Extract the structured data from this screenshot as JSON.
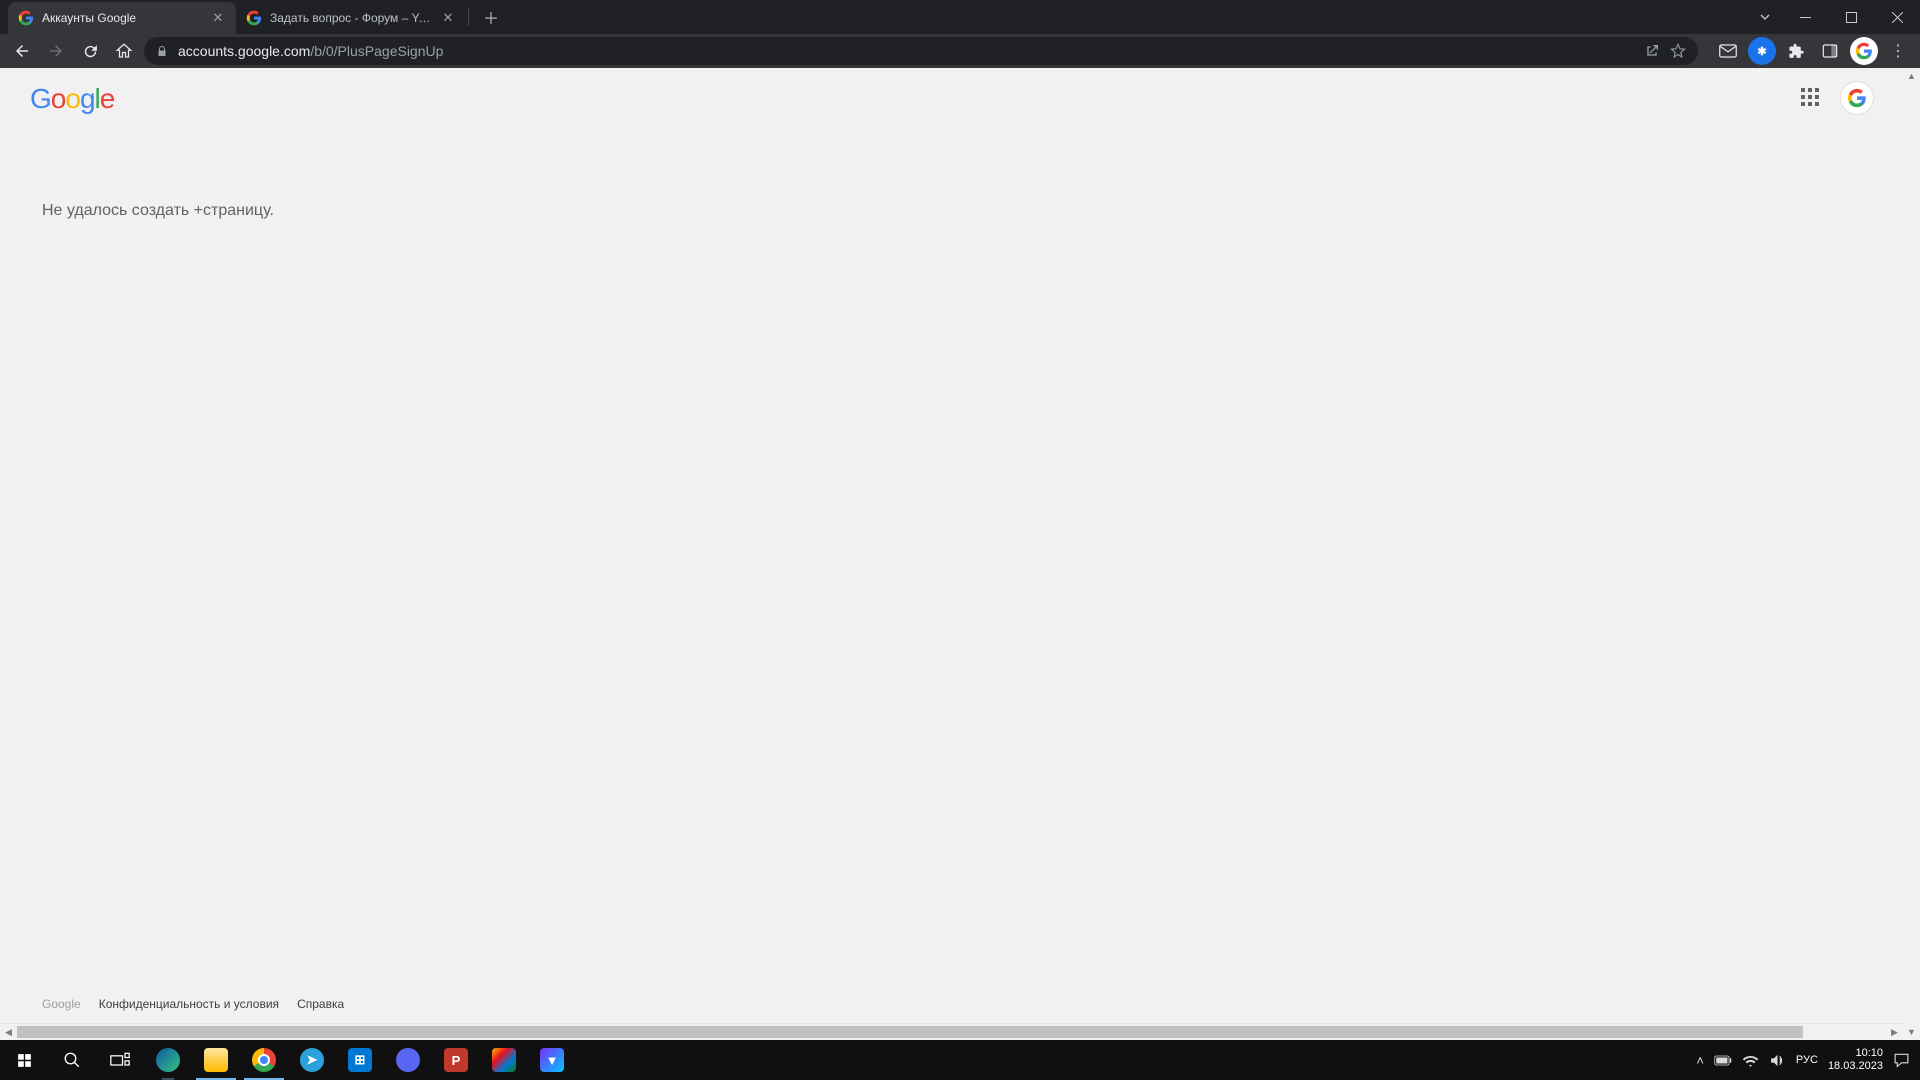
{
  "browser": {
    "tabs": [
      {
        "title": "Аккаунты Google",
        "active": true
      },
      {
        "title": "Задать вопрос - Форум – YouTu",
        "active": false
      }
    ],
    "url_host": "accounts.google.com",
    "url_path": "/b/0/PlusPageSignUp"
  },
  "page": {
    "logo_text": "Google",
    "message": "Не удалось создать +страницу.",
    "footer": {
      "brand": "Google",
      "privacy": "Конфиденциальность и условия",
      "help": "Справка"
    }
  },
  "taskbar": {
    "lang": "РУС",
    "time": "10:10",
    "date": "18.03.2023"
  }
}
